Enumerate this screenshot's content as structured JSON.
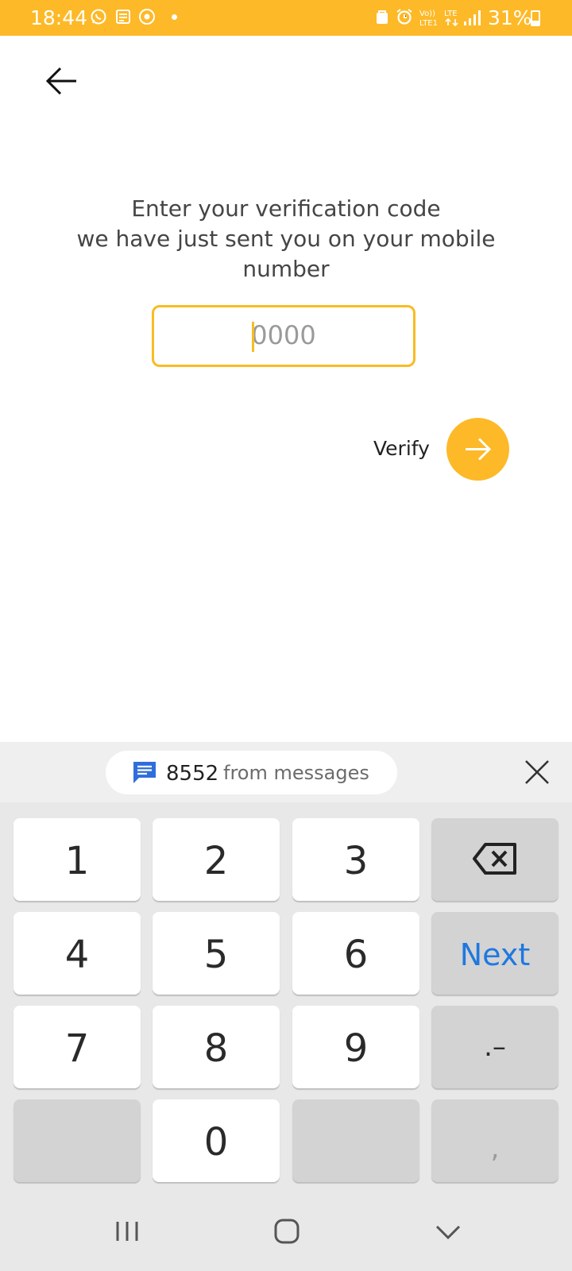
{
  "status_bar": {
    "time": "18:44",
    "battery": "31%",
    "battery_level": 0.31,
    "left_icons": [
      "whatsapp-icon",
      "news-icon",
      "chrome-icon",
      "notification-dot"
    ],
    "right_icons": [
      "app-lock-icon",
      "alarm-icon",
      "volte-icon",
      "lte-icon",
      "signal-icon",
      "battery-icon"
    ],
    "network_labels": {
      "volte_top": "Vo))",
      "volte_bottom": "LTE1",
      "lte": "LTE"
    },
    "background_color": "#fdb927"
  },
  "header": {
    "back_icon": "arrow-left-icon"
  },
  "instruction": {
    "line1": "Enter your verification code",
    "line2": "we have just sent you on your mobile",
    "line3": "number"
  },
  "code_input": {
    "placeholder": "0000",
    "value": "",
    "border_color": "#f9bc22"
  },
  "verify": {
    "label": "Verify",
    "button_icon": "arrow-right-icon",
    "button_color": "#fdb927"
  },
  "keyboard": {
    "suggestion": {
      "icon": "message-icon",
      "code": "8552",
      "source": "from messages",
      "close_icon": "close-icon"
    },
    "keys": {
      "k1": "1",
      "k2": "2",
      "k3": "3",
      "k4": "4",
      "k5": "5",
      "k6": "6",
      "k7": "7",
      "k8": "8",
      "k9": "9",
      "k0": "0",
      "next": "Next",
      "symbols": ".–",
      "comma": ","
    },
    "backspace_icon": "backspace-icon",
    "next_color": "#1f78e0"
  },
  "nav_bar": {
    "icons": [
      "recent-apps-icon",
      "home-icon",
      "hide-keyboard-icon"
    ]
  }
}
